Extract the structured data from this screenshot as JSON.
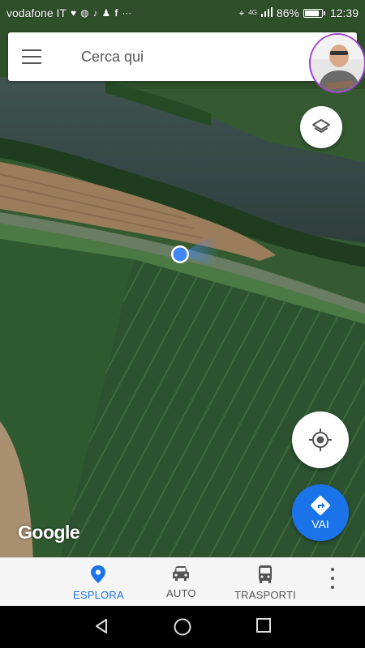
{
  "status_bar": {
    "carrier": "vodafone IT",
    "notification_icons": [
      "heart-pulse-icon",
      "messenger-icon",
      "music-icon",
      "person-icon",
      "facebook-icon",
      "more-dots-icon"
    ],
    "overflow_indicator": "···",
    "network": "4G",
    "battery_percent": "86%",
    "battery_level": 0.86,
    "time": "12:39"
  },
  "search": {
    "placeholder": "Cerca qui"
  },
  "map": {
    "attribution": "Google"
  },
  "fab": {
    "go_label": "VAI"
  },
  "bottom_nav": {
    "items": [
      {
        "label": "ESPLORA",
        "icon": "explore-pin-icon",
        "active": true
      },
      {
        "label": "AUTO",
        "icon": "car-icon",
        "active": false
      },
      {
        "label": "TRASPORTI",
        "icon": "bus-icon",
        "active": false
      }
    ]
  },
  "colors": {
    "accent": "#1a73e8",
    "location_dot": "#4285f4",
    "avatar_ring": "#a040d0"
  }
}
